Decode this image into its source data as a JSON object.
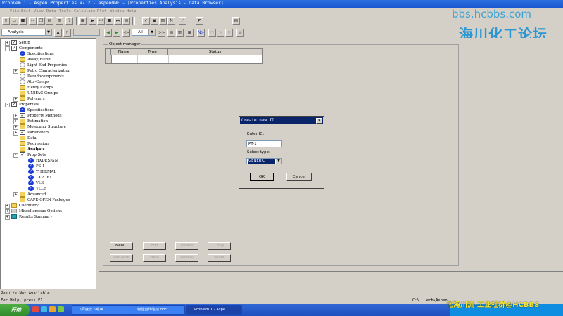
{
  "window": {
    "title": "Problem 1 - Aspen Properties V7.2 - aspenONE - [Properties Analysis - Data Browser]"
  },
  "menu": [
    "File",
    "Edit",
    "View",
    "Data",
    "Tools",
    "Calculate",
    "Plot",
    "Window",
    "Help"
  ],
  "watermark": {
    "line1": "bbs.hcbbs.com",
    "line2": "海川化工论坛",
    "footer": "化海川流-工业社群@HCBBS"
  },
  "toolbar": {
    "nav_combo_value": "Analysis",
    "filter_combo_value": "All",
    "prev_label": "<<",
    "next_label": ">>",
    "nplus_label": "N>"
  },
  "tree": [
    {
      "label": "Setup",
      "level": 0,
      "icon": "check",
      "expander": "+"
    },
    {
      "label": "Components",
      "level": 0,
      "icon": "check",
      "expander": "-"
    },
    {
      "label": "Specifications",
      "level": 1,
      "icon": "blue"
    },
    {
      "label": "Assay/Blend",
      "level": 1,
      "icon": "folder"
    },
    {
      "label": "Light-End Properties",
      "level": 1,
      "icon": "empty"
    },
    {
      "label": "Petro Characterization",
      "level": 1,
      "icon": "folder",
      "expander": "+"
    },
    {
      "label": "Pseudocomponents",
      "level": 1,
      "icon": "empty"
    },
    {
      "label": "Attr-Comps",
      "level": 1,
      "icon": "empty"
    },
    {
      "label": "Henry Comps",
      "level": 1,
      "icon": "folder"
    },
    {
      "label": "UNIFAC Groups",
      "level": 1,
      "icon": "folder"
    },
    {
      "label": "Polymers",
      "level": 1,
      "icon": "folder",
      "expander": "+"
    },
    {
      "label": "Properties",
      "level": 0,
      "icon": "check",
      "expander": "-"
    },
    {
      "label": "Specifications",
      "level": 1,
      "icon": "blue"
    },
    {
      "label": "Property Methods",
      "level": 1,
      "icon": "check",
      "expander": "+"
    },
    {
      "label": "Estimation",
      "level": 1,
      "icon": "folder",
      "expander": "+"
    },
    {
      "label": "Molecular Structure",
      "level": 1,
      "icon": "folder",
      "expander": "+"
    },
    {
      "label": "Parameters",
      "level": 1,
      "icon": "check",
      "expander": "+"
    },
    {
      "label": "Data",
      "level": 1,
      "icon": "folder"
    },
    {
      "label": "Regression",
      "level": 1,
      "icon": "folder"
    },
    {
      "label": "Analysis",
      "level": 1,
      "icon": "folder",
      "bold": true
    },
    {
      "label": "Prop-Sets",
      "level": 1,
      "icon": "check",
      "expander": "-"
    },
    {
      "label": "HXDESIGN",
      "level": 2,
      "icon": "blue"
    },
    {
      "label": "PS-1",
      "level": 2,
      "icon": "blue"
    },
    {
      "label": "THERMAL",
      "level": 2,
      "icon": "blue"
    },
    {
      "label": "TXPORT",
      "level": 2,
      "icon": "blue"
    },
    {
      "label": "VLE",
      "level": 2,
      "icon": "blue"
    },
    {
      "label": "VLLE",
      "level": 2,
      "icon": "blue"
    },
    {
      "label": "Advanced",
      "level": 1,
      "icon": "folder",
      "expander": "+"
    },
    {
      "label": "CAPE-OPEN Packages",
      "level": 1,
      "icon": "folder"
    },
    {
      "label": "Chemistry",
      "level": 0,
      "icon": "folder",
      "expander": "+"
    },
    {
      "label": "Miscellaneous Options",
      "level": 0,
      "icon": "gray",
      "expander": "+"
    },
    {
      "label": "Results Summary",
      "level": 0,
      "icon": "teal",
      "expander": "+"
    }
  ],
  "object_manager": {
    "caption": "Object manager",
    "columns": [
      "Name",
      "Type",
      "Status"
    ]
  },
  "buttons": {
    "new": "New...",
    "edit": "Edit",
    "delete": "Delete",
    "copy": "Copy",
    "rename": "Rename",
    "hide": "Hide",
    "reveal": "Reveal",
    "paste": "Paste"
  },
  "dialog": {
    "title": "Create new ID",
    "close": "x",
    "enter_id_label": "Enter ID:",
    "id_value": "PT-1",
    "select_type_label": "Select type:",
    "type_value": "GENERIC",
    "ok": "OK",
    "cancel": "Cancel"
  },
  "status": {
    "results": "Results Not Available",
    "help": "For Help, press F1",
    "path": "C:\\...ech\\Aspen"
  },
  "taskbar": {
    "start": "开始",
    "tasks": [
      {
        "label": "\\百度云下载\\A...",
        "active": false
      },
      {
        "label": "物性查询笔记.doc",
        "active": false
      },
      {
        "label": "Problem 1 - Aspe...",
        "active": true
      }
    ]
  }
}
